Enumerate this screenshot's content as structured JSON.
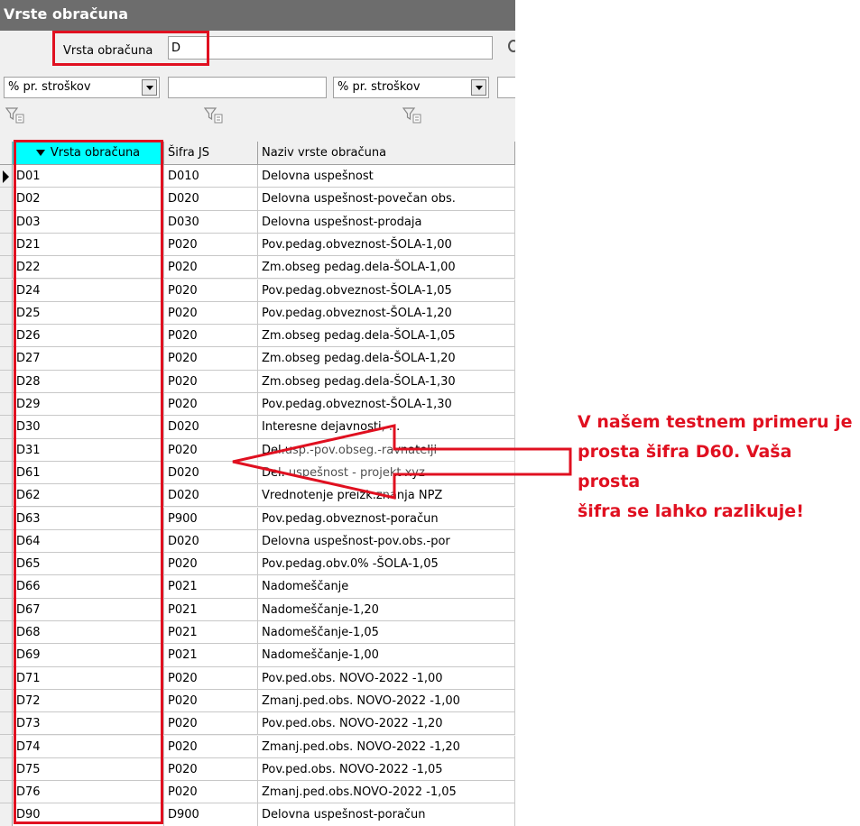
{
  "window": {
    "title": "Vrste obračuna"
  },
  "search": {
    "label": "Vrsta obračuna",
    "value": "D"
  },
  "filters": {
    "dropdown1": "% pr. stroškov",
    "textbox1": "",
    "dropdown2": "% pr. stroškov",
    "textbox2": ""
  },
  "table": {
    "columns": [
      "Vrsta obračuna",
      "Šifra JS",
      "Naziv vrste obračuna"
    ],
    "sorted_column": "Vrsta obračuna",
    "rows": [
      [
        "D01",
        "D010",
        "Delovna uspešnost"
      ],
      [
        "D02",
        "D020",
        "Delovna uspešnost-povečan obs."
      ],
      [
        "D03",
        "D030",
        "Delovna uspešnost-prodaja"
      ],
      [
        "D21",
        "P020",
        "Pov.pedag.obveznost-ŠOLA-1,00"
      ],
      [
        "D22",
        "P020",
        "Zm.obseg pedag.dela-ŠOLA-1,00"
      ],
      [
        "D24",
        "P020",
        "Pov.pedag.obveznost-ŠOLA-1,05"
      ],
      [
        "D25",
        "P020",
        "Pov.pedag.obveznost-ŠOLA-1,20"
      ],
      [
        "D26",
        "P020",
        "Zm.obseg pedag.dela-ŠOLA-1,05"
      ],
      [
        "D27",
        "P020",
        "Zm.obseg pedag.dela-ŠOLA-1,20"
      ],
      [
        "D28",
        "P020",
        "Zm.obseg pedag.dela-ŠOLA-1,30"
      ],
      [
        "D29",
        "P020",
        "Pov.pedag.obveznost-ŠOLA-1,30"
      ],
      [
        "D30",
        "D020",
        "Interesne dejavnosti, ..."
      ],
      [
        "D31",
        "P020",
        "Del.usp.-pov.obseg.-ravnatelji"
      ],
      [
        "D61",
        "D020",
        "Del. uspešnost - projekt xyz"
      ],
      [
        "D62",
        "D020",
        "Vrednotenje preizk.znanja NPZ"
      ],
      [
        "D63",
        "P900",
        "Pov.pedag.obveznost-poračun"
      ],
      [
        "D64",
        "D020",
        "Delovna uspešnost-pov.obs.-por"
      ],
      [
        "D65",
        "P020",
        "Pov.pedag.obv.0% -ŠOLA-1,05"
      ],
      [
        "D66",
        "P021",
        "Nadomeščanje"
      ],
      [
        "D67",
        "P021",
        "Nadomeščanje-1,20"
      ],
      [
        "D68",
        "P021",
        "Nadomeščanje-1,05"
      ],
      [
        "D69",
        "P021",
        "Nadomeščanje-1,00"
      ],
      [
        "D71",
        "P020",
        "Pov.ped.obs. NOVO-2022 -1,00"
      ],
      [
        "D72",
        "P020",
        "Zmanj.ped.obs. NOVO-2022 -1,00"
      ],
      [
        "D73",
        "P020",
        "Pov.ped.obs. NOVO-2022 -1,20"
      ],
      [
        "D74",
        "P020",
        "Zmanj.ped.obs. NOVO-2022 -1,20"
      ],
      [
        "D75",
        "P020",
        "Pov.ped.obs. NOVO-2022 -1,05"
      ],
      [
        "D76",
        "P020",
        "Zmanj.ped.obs.NOVO-2022 -1,05"
      ],
      [
        "D90",
        "D900",
        "Delovna uspešnost-poračun"
      ]
    ]
  },
  "annotation": {
    "text_lines": [
      "V našem testnem primeru je",
      "prosta šifra D60. Vaša prosta",
      "šifra se lahko razlikuje!"
    ],
    "color": "#e01020"
  },
  "colors": {
    "titlebar": "#6d6d6d",
    "sorted_header": "#00ffff",
    "highlight": "#e01020"
  },
  "icons": [
    "filter-icon",
    "search-icon",
    "sort-down-icon",
    "current-row-icon",
    "dropdown-arrow-icon"
  ]
}
